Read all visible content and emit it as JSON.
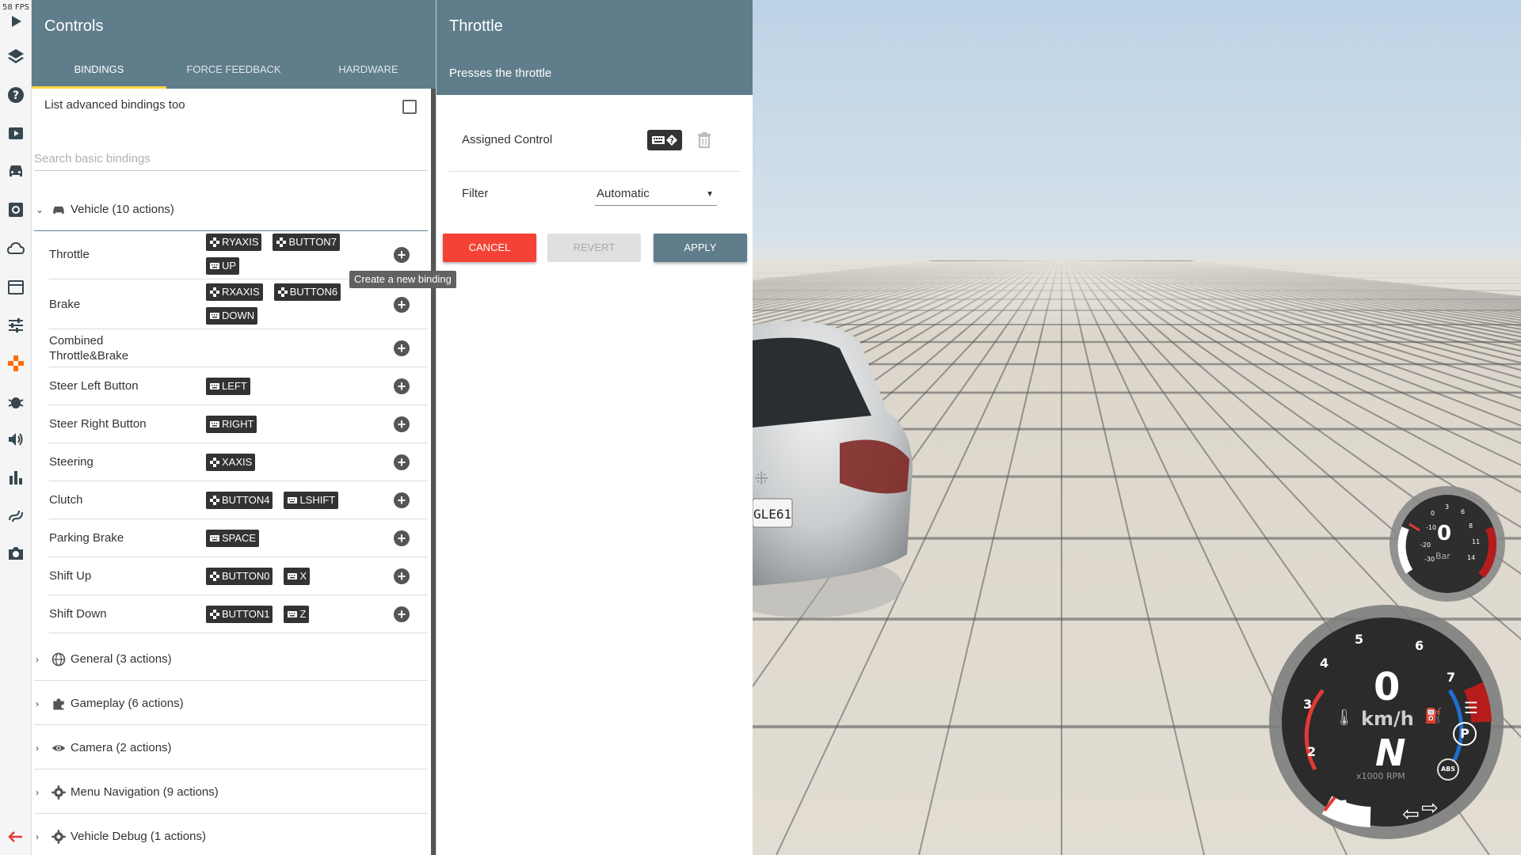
{
  "fps": "58 FPS",
  "controls": {
    "title": "Controls",
    "tabs": [
      {
        "label": "Bindings",
        "active": true
      },
      {
        "label": "Force Feedback",
        "active": false
      },
      {
        "label": "Hardware",
        "active": false
      }
    ],
    "advanced_label": "List advanced bindings too",
    "search_placeholder": "Search basic bindings",
    "vehicle_group": "Vehicle (10 actions)",
    "actions": [
      {
        "label": "Throttle",
        "bindings": [
          {
            "type": "gamepad",
            "text": "RYAXIS"
          },
          {
            "type": "gamepad",
            "text": "BUTTON7"
          },
          {
            "type": "keyboard",
            "text": "UP"
          }
        ]
      },
      {
        "label": "Brake",
        "bindings": [
          {
            "type": "gamepad",
            "text": "RXAXIS"
          },
          {
            "type": "gamepad",
            "text": "BUTTON6"
          },
          {
            "type": "keyboard",
            "text": "DOWN"
          }
        ]
      },
      {
        "label": "Combined Throttle&Brake",
        "bindings": []
      },
      {
        "label": "Steer Left Button",
        "bindings": [
          {
            "type": "keyboard",
            "text": "LEFT"
          }
        ]
      },
      {
        "label": "Steer Right Button",
        "bindings": [
          {
            "type": "keyboard",
            "text": "RIGHT"
          }
        ]
      },
      {
        "label": "Steering",
        "bindings": [
          {
            "type": "gamepad",
            "text": "XAXIS"
          }
        ]
      },
      {
        "label": "Clutch",
        "bindings": [
          {
            "type": "gamepad",
            "text": "BUTTON4"
          },
          {
            "type": "keyboard",
            "text": "LSHIFT"
          }
        ]
      },
      {
        "label": "Parking Brake",
        "bindings": [
          {
            "type": "keyboard",
            "text": "SPACE"
          }
        ]
      },
      {
        "label": "Shift Up",
        "bindings": [
          {
            "type": "gamepad",
            "text": "BUTTON0"
          },
          {
            "type": "keyboard",
            "text": "X"
          }
        ]
      },
      {
        "label": "Shift Down",
        "bindings": [
          {
            "type": "gamepad",
            "text": "BUTTON1"
          },
          {
            "type": "keyboard",
            "text": "Z"
          }
        ]
      }
    ],
    "groups": [
      {
        "label": "General (3 actions)",
        "icon": "globe-icon"
      },
      {
        "label": "Gameplay (6 actions)",
        "icon": "puzzle-icon"
      },
      {
        "label": "Camera (2 actions)",
        "icon": "eye-icon"
      },
      {
        "label": "Menu Navigation (9 actions)",
        "icon": "gear-icon"
      },
      {
        "label": "Vehicle Debug (1 actions)",
        "icon": "gear-icon"
      }
    ],
    "tooltip": "Create a new binding"
  },
  "detail": {
    "title": "Throttle",
    "description": "Presses the throttle",
    "assigned_label": "Assigned Control",
    "filter_label": "Filter",
    "filter_value": "Automatic",
    "cancel": "Cancel",
    "revert": "Revert",
    "apply": "Apply"
  },
  "hud": {
    "plate": "GLE61",
    "boost": {
      "value": "0",
      "unit": "Bar",
      "ticks": [
        "-30",
        "-20",
        "-10",
        "0",
        "3",
        "6",
        "8",
        "11",
        "14"
      ]
    },
    "speed": {
      "value": "0",
      "unit": "km/h",
      "gear": "N",
      "rpm_label": "x1000 RPM",
      "ticks": [
        "1",
        "2",
        "3",
        "4",
        "5",
        "6",
        "7"
      ]
    },
    "indicators": [
      "P",
      "ABS"
    ]
  },
  "colors": {
    "header": "#607d8b",
    "accent": "#ffd740",
    "cancel": "#f44336",
    "active_icon": "#ff6f00"
  }
}
